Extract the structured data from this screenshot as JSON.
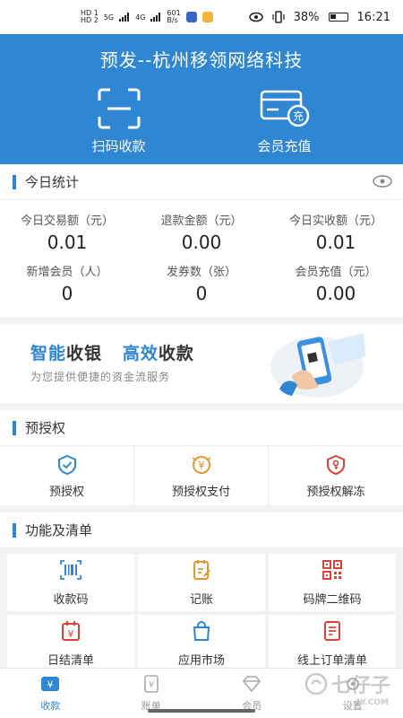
{
  "status_bar": {
    "carrier1": "HD 1",
    "carrier2": "HD 2",
    "net1": "5G",
    "net2": "4G",
    "speed": "601",
    "speed_unit": "B/s",
    "battery": "38%",
    "time": "16:21"
  },
  "header": {
    "title": "预发--杭州移领网络科技",
    "actions": [
      {
        "label": "扫码收款",
        "icon": "scan-icon"
      },
      {
        "label": "会员充值",
        "icon": "card-recharge-icon"
      }
    ]
  },
  "stats": {
    "title": "今日统计",
    "items": [
      {
        "label": "今日交易额（元）",
        "value": "0.01"
      },
      {
        "label": "退款金额（元）",
        "value": "0.00"
      },
      {
        "label": "今日实收额（元）",
        "value": "0.01"
      },
      {
        "label": "新增会员（人）",
        "value": "0"
      },
      {
        "label": "发券数（张）",
        "value": "0"
      },
      {
        "label": "会员充值（元）",
        "value": "0.00"
      }
    ]
  },
  "banner": {
    "part1": "智能",
    "part2": "收银",
    "part3": "高效",
    "part4": "收款",
    "subtitle": "为您提供便捷的资金流服务"
  },
  "preauth": {
    "title": "预授权",
    "items": [
      {
        "label": "预授权",
        "icon": "shield-check-icon"
      },
      {
        "label": "预授权支付",
        "icon": "yuan-coin-icon"
      },
      {
        "label": "预授权解冻",
        "icon": "shield-key-icon"
      }
    ]
  },
  "functions": {
    "title": "功能及清单",
    "items": [
      {
        "label": "收款码",
        "icon": "barcode-icon"
      },
      {
        "label": "记账",
        "icon": "notebook-icon"
      },
      {
        "label": "码牌二维码",
        "icon": "qrcode-icon"
      },
      {
        "label": "日结清单",
        "icon": "calendar-yuan-icon"
      },
      {
        "label": "应用市场",
        "icon": "shopping-bag-icon"
      },
      {
        "label": "线上订单清单",
        "icon": "order-list-icon"
      }
    ]
  },
  "tabs": [
    {
      "label": "收款",
      "active": true
    },
    {
      "label": "账单",
      "active": false
    },
    {
      "label": "会员",
      "active": false
    },
    {
      "label": "设置",
      "active": false
    }
  ],
  "watermark": {
    "text": "七仔子",
    "sub": "7Y.COM"
  },
  "colors": {
    "primary": "#2f86d2",
    "accent_orange": "#e8962e",
    "accent_red": "#d9433a"
  }
}
